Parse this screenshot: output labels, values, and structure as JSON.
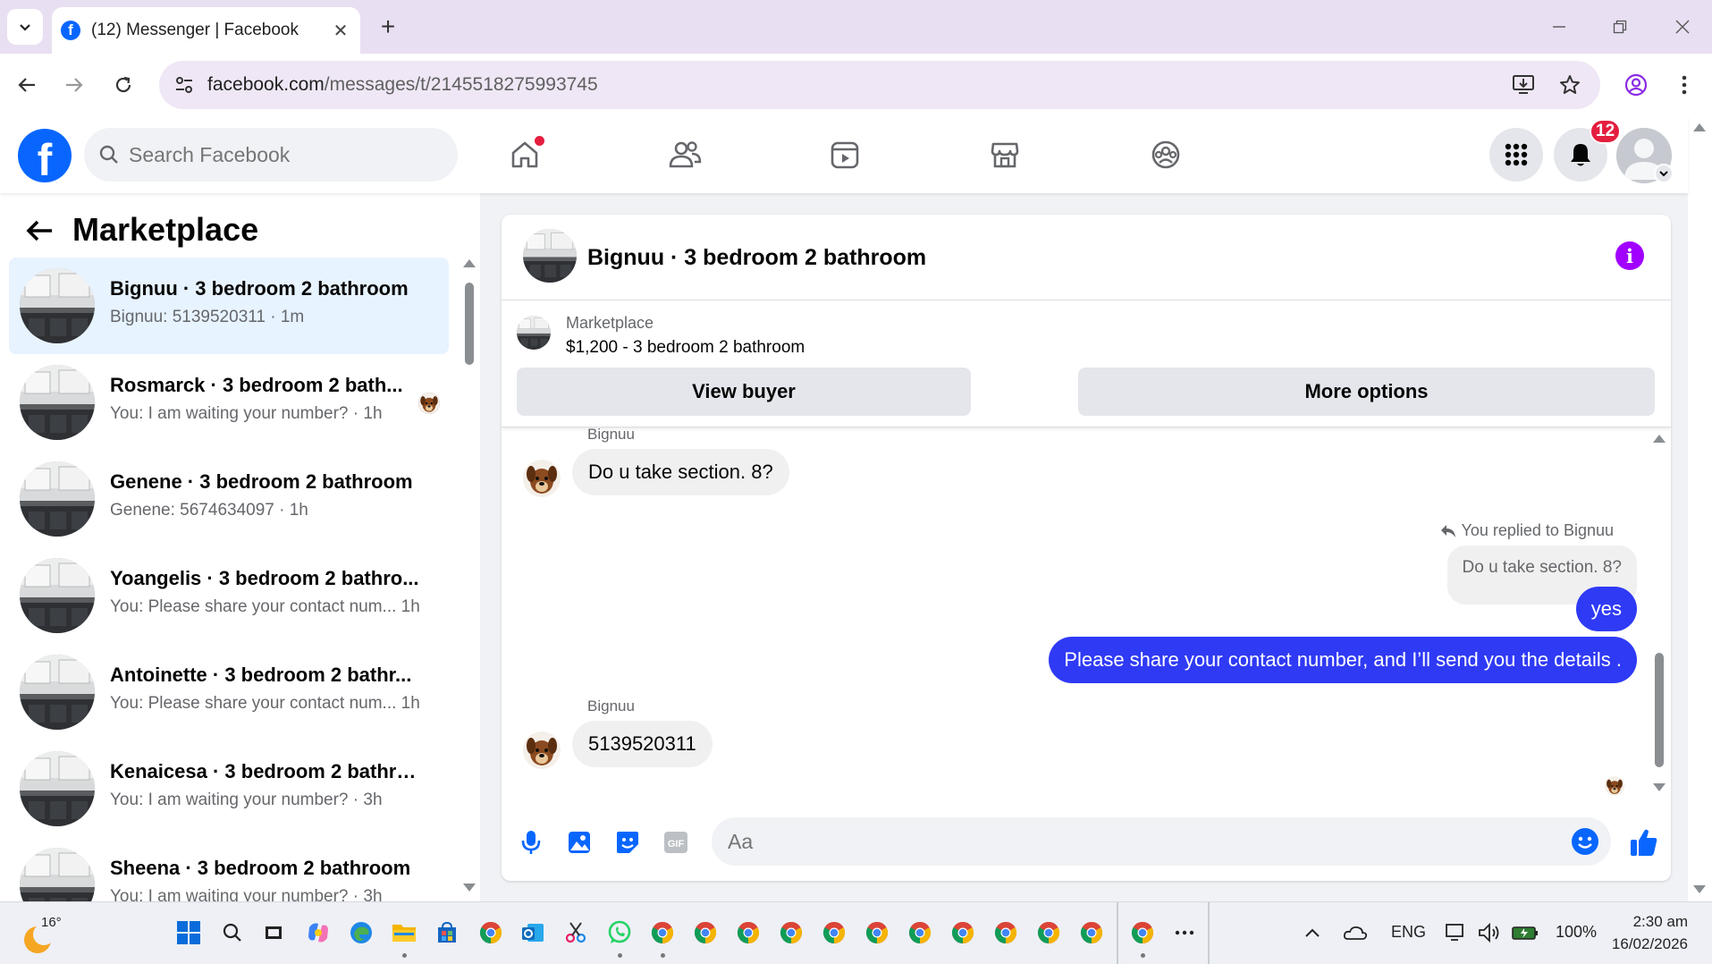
{
  "browser": {
    "tab_title": "(12) Messenger | Facebook",
    "url_host": "facebook.com",
    "url_path": "/messages/t/2145518275993745"
  },
  "fb": {
    "search_placeholder": "Search Facebook",
    "notification_count": "12",
    "brand_color": "#0866ff"
  },
  "left_panel": {
    "title": "Marketplace",
    "conversations": [
      {
        "name": "Bignuu · 3 bedroom 2 bathroom",
        "preview": "Bignuu: 5139520311 · 1m",
        "active": true
      },
      {
        "name": "Rosmarck · 3 bedroom 2 bath...",
        "preview": "You: I am waiting your number? · 1h",
        "seen": true
      },
      {
        "name": "Genene · 3 bedroom 2 bathroom",
        "preview": "Genene: 5674634097 · 1h"
      },
      {
        "name": "Yoangelis · 3 bedroom 2 bathro...",
        "preview": "You: Please share your contact num...   1h"
      },
      {
        "name": "Antoinette · 3 bedroom 2 bathr...",
        "preview": "You: Please share your contact num...   1h"
      },
      {
        "name": "Kenaicesa · 3 bedroom 2 bathro...",
        "preview": "You: I am waiting your number? · 3h"
      },
      {
        "name": "Sheena · 3 bedroom 2 bathroom",
        "preview": "You: I am waiting your number? · 3h"
      }
    ]
  },
  "chat": {
    "title": "Bignuu · 3 bedroom 2 bathroom",
    "listing_source": "Marketplace",
    "listing_price": "$1,200 - 3 bedroom 2 bathroom",
    "view_buyer": "View buyer",
    "more_options": "More options",
    "sender": "Bignuu",
    "msg1": "Do u take section. 8?",
    "reply_label": "You replied to Bignuu",
    "reply_quote": "Do u take section. 8?",
    "msg_yes": "yes",
    "msg_out2": "Please share your contact number, and I’ll send you the details .",
    "msg3": "5139520311",
    "composer_placeholder": "Aa",
    "outgoing_color": "#2f3af5"
  },
  "taskbar": {
    "weather_temp": "16°",
    "language": "ENG",
    "battery": "100%",
    "time": "2:30 am",
    "date": "16/02/2026"
  }
}
